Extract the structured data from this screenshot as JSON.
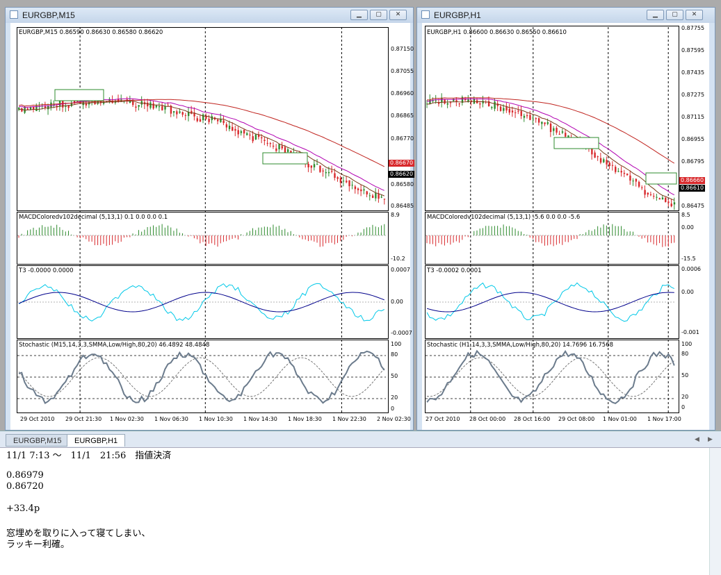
{
  "windows": [
    {
      "id": "m15",
      "title": "EURGBP,M15",
      "price_label": "EURGBP,M15  0.86590 0.86630 0.86580 0.86620",
      "price_axis": [
        "0.87150",
        "0.87055",
        "0.86960",
        "0.86865",
        "0.86770",
        "0.86670",
        "0.86620",
        "0.86580",
        "0.86485"
      ],
      "price_tags": [
        {
          "text": "0.86670",
          "color": "#d8282b"
        },
        {
          "text": "0.86620",
          "color": "#000000"
        }
      ],
      "annotations": [
        "0.86979",
        "0.86720"
      ],
      "macd_label": "MACDColoredv102decimal (5,13,1) 0.1 0.0 0.0 0.1",
      "macd_axis": [
        "8.9",
        "-10.2"
      ],
      "t3_label": "T3 -0.0000 0.0000",
      "t3_axis": [
        "0.0007",
        "0.00",
        "-0.0007"
      ],
      "stoch_label": "Stochastic (M15,14,3,3,SMMA,Low/High,80,20) 46.4892 48.4848",
      "stoch_axis": [
        "100",
        "80",
        "50",
        "20",
        "0"
      ],
      "time_axis": [
        "29 Oct 2010",
        "29 Oct 21:30",
        "1 Nov 02:30",
        "1 Nov 06:30",
        "1 Nov 10:30",
        "1 Nov 14:30",
        "1 Nov 18:30",
        "1 Nov 22:30",
        "2 Nov 02:30"
      ]
    },
    {
      "id": "h1",
      "title": "EURGBP,H1",
      "price_label": "EURGBP,H1  0.86600 0.86630 0.86550 0.86610",
      "price_axis": [
        "0.87755",
        "0.87595",
        "0.87435",
        "0.87275",
        "0.87115",
        "0.86955",
        "0.86795",
        "0.86660",
        "0.86610",
        "0.86475"
      ],
      "price_tags": [
        {
          "text": "0.86660",
          "color": "#d8282b"
        },
        {
          "text": "0.86610",
          "color": "#000000"
        }
      ],
      "annotations": [
        "0.86979",
        "0.867"
      ],
      "macd_label": "MACDColoredv102decimal (5,13,1) -5.6 0.0 0.0 -5.6",
      "macd_axis": [
        "8.5",
        "0.00",
        "-15.5"
      ],
      "t3_label": "T3 -0.0002 0.0001",
      "t3_axis": [
        "0.0006",
        "0.00",
        "-0.001"
      ],
      "stoch_label": "Stochastic (H1,14,3,3,SMMA,Low/High,80,20) 14.7696 16.7568",
      "stoch_axis": [
        "100",
        "80",
        "50",
        "20",
        "0"
      ],
      "time_axis": [
        "27 Oct 2010",
        "28 Oct 00:00",
        "28 Oct 16:00",
        "29 Oct 08:00",
        "1 Nov 01:00",
        "1 Nov 17:00"
      ]
    }
  ],
  "tabs": [
    "EURGBP,M15",
    "EURGBP,H1"
  ],
  "note_lines": [
    "11/1 7:13 ～　11/1　21:56　指値決済",
    "",
    "0.86979",
    "0.86720",
    "",
    "+33.4p",
    "",
    "窓埋めを取りに入って寝てしまい、",
    "ラッキー利確。"
  ],
  "colors": {
    "bull": "#2e8b2e",
    "bear": "#d8282b",
    "ma_slow": "#c0241f",
    "ma_fast": "#b100b1",
    "cyan": "#00c8e8",
    "stoch": "#6b7b8c"
  }
}
